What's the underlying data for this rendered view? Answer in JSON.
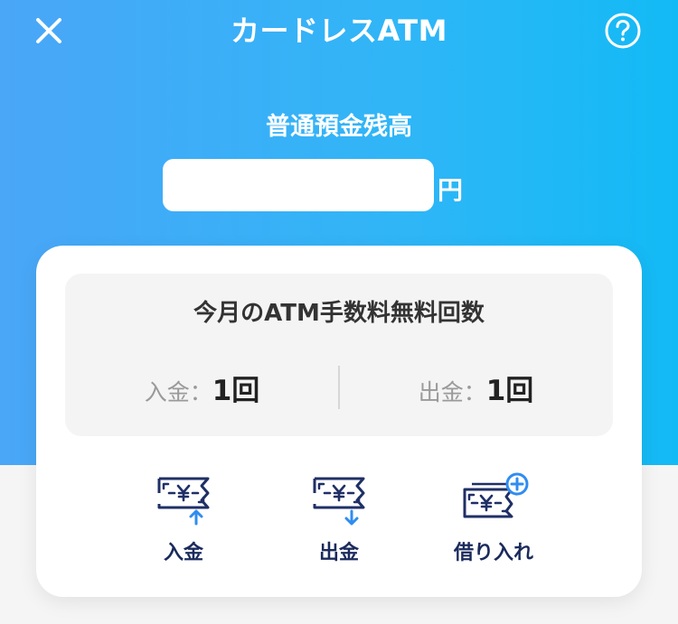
{
  "header": {
    "title": "カードレスATM"
  },
  "balance": {
    "label": "普通預金残高",
    "amount": "",
    "unit": "円"
  },
  "fees": {
    "title": "今月のATM手数料無料回数",
    "deposit": {
      "label": "入金：",
      "count": "1回"
    },
    "withdraw": {
      "label": "出金：",
      "count": "1回"
    }
  },
  "actions": [
    {
      "label": "入金",
      "icon": "deposit-icon"
    },
    {
      "label": "出金",
      "icon": "withdraw-icon"
    },
    {
      "label": "借り入れ",
      "icon": "borrow-icon"
    }
  ],
  "colors": {
    "header_gradient_start": "#4aa6f7",
    "header_gradient_end": "#12baf5",
    "icon_navy": "#1f2f66",
    "icon_accent": "#2f8df0",
    "action_text": "#1a2a5c"
  }
}
